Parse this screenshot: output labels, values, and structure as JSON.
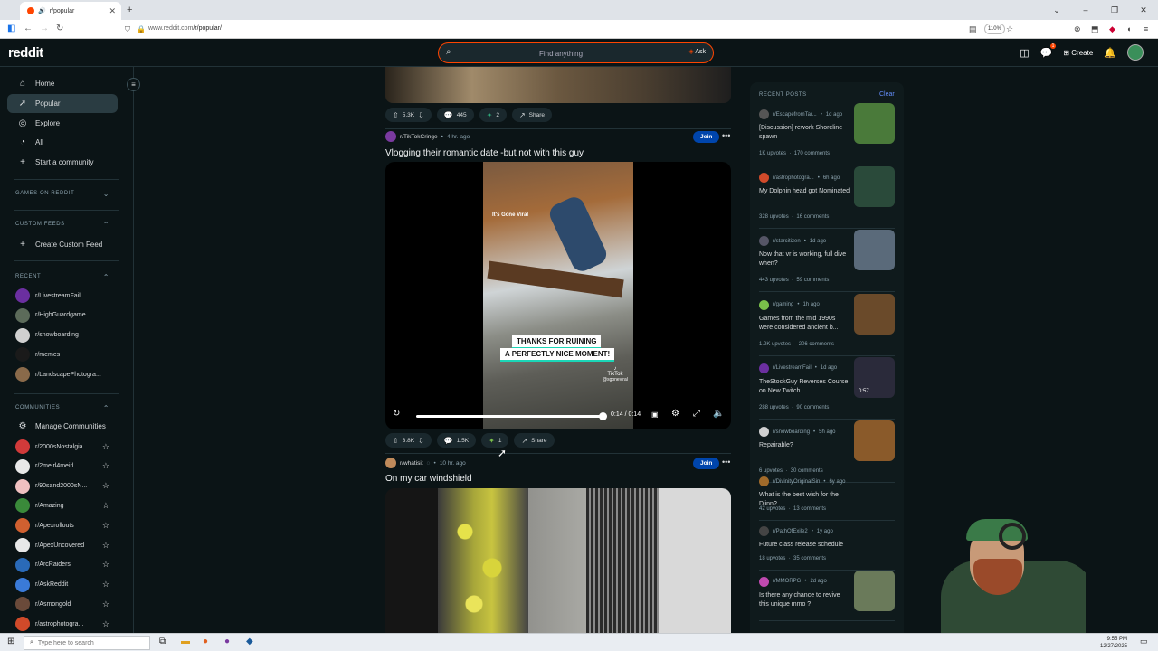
{
  "browser": {
    "tab_title": "r/popular",
    "url_host": "www.reddit.com",
    "url_path": "/r/popular/",
    "zoom": "110%"
  },
  "header": {
    "logo": "reddit",
    "search_placeholder": "Find anything",
    "ask_label": "Ask",
    "create_label": "Create",
    "chat_badge": "1"
  },
  "sidebar": {
    "nav": [
      {
        "label": "Home",
        "icon": "home-icon"
      },
      {
        "label": "Popular",
        "icon": "popular-icon"
      },
      {
        "label": "Explore",
        "icon": "explore-icon"
      },
      {
        "label": "All",
        "icon": "all-icon"
      },
      {
        "label": "Start a community",
        "icon": "plus-icon"
      }
    ],
    "games_header": "GAMES ON REDDIT",
    "custom_feeds_header": "CUSTOM FEEDS",
    "create_custom_feed": "Create Custom Feed",
    "recent_header": "RECENT",
    "recent": [
      {
        "name": "r/LivestreamFail",
        "color": "#6b2fa0"
      },
      {
        "name": "r/HighGuardgame",
        "color": "#5c6b5a"
      },
      {
        "name": "r/snowboarding",
        "color": "#d0d0d0"
      },
      {
        "name": "r/memes",
        "color": "#1a1a1a"
      },
      {
        "name": "r/LandscapePhotogra...",
        "color": "#8a6a4a"
      }
    ],
    "communities_header": "COMMUNITIES",
    "manage_communities": "Manage Communities",
    "communities": [
      {
        "name": "r/2000sNostalgia",
        "color": "#d13a3a"
      },
      {
        "name": "r/2meirl4meirl",
        "color": "#e8e8e8"
      },
      {
        "name": "r/90sand2000sN...",
        "color": "#f0c0c0"
      },
      {
        "name": "r/Amazing",
        "color": "#3a8a3a"
      },
      {
        "name": "r/Apexrollouts",
        "color": "#d06030"
      },
      {
        "name": "r/ApexUncovered",
        "color": "#e8e8e8"
      },
      {
        "name": "r/ArcRaiders",
        "color": "#2a6ab8"
      },
      {
        "name": "r/AskReddit",
        "color": "#3a7ad8"
      },
      {
        "name": "r/Asmongold",
        "color": "#6a4a3a"
      },
      {
        "name": "r/astrophotogra...",
        "color": "#d04a2a"
      }
    ]
  },
  "feed": {
    "post1": {
      "upvotes": "5.3K",
      "comments": "445",
      "awards": "2",
      "share": "Share"
    },
    "post2": {
      "subreddit": "r/TikTokCringe",
      "age": "4 hr. ago",
      "join": "Join",
      "title": "Vlogging their romantic date -but not with this guy",
      "video_overlay": "It's Gone Viral",
      "caption_line1": "THANKS FOR RUINING",
      "caption_line2": "A PERFECTLY NICE MOMENT!",
      "tiktok_label": "TikTok",
      "tiktok_handle": "@sgoneviral",
      "time": "0:14 / 0:14",
      "progress": 1.0,
      "upvotes": "3.8K",
      "comments": "1.5K",
      "awards": "1",
      "share": "Share"
    },
    "post3": {
      "subreddit": "r/whatisit",
      "age": "10 hr. ago",
      "join": "Join",
      "title": "On my car windshield"
    }
  },
  "recent_posts": {
    "header": "RECENT POSTS",
    "clear": "Clear",
    "items": [
      {
        "sub": "r/EscapefromTar...",
        "age": "1d ago",
        "title": "[Discussion] rework Shoreline spawn",
        "upvotes": "1K upvotes",
        "comments": "170 comments",
        "avatar": "#555",
        "thumb": "#4a7a3a"
      },
      {
        "sub": "r/astrophotogra...",
        "age": "6h ago",
        "title": "My Dolphin head got Nominated",
        "upvotes": "328 upvotes",
        "comments": "16 comments",
        "avatar": "#d04a2a",
        "thumb": "#2a4a3a"
      },
      {
        "sub": "r/starcitizen",
        "age": "1d ago",
        "title": "Now that vr is working, full dive when?",
        "upvotes": "443 upvotes",
        "comments": "59 comments",
        "avatar": "#556",
        "thumb": "#5a6a7a"
      },
      {
        "sub": "r/gaming",
        "age": "1h ago",
        "title": "Games from the mid 1990s were considered ancient b...",
        "upvotes": "1.2K upvotes",
        "comments": "206 comments",
        "avatar": "#7ac04a",
        "thumb": "#6a4a2a"
      },
      {
        "sub": "r/LivestreamFail",
        "age": "1d ago",
        "title": "TheStockGuy Reverses Course on New Twitch...",
        "upvotes": "288 upvotes",
        "comments": "90 comments",
        "avatar": "#6b2fa0",
        "thumb": "#2a2a3a",
        "duration": "0:57"
      },
      {
        "sub": "r/snowboarding",
        "age": "5h ago",
        "title": "Repairable?",
        "upvotes": "6 upvotes",
        "comments": "30 comments",
        "avatar": "#d0d0d0",
        "thumb": "#8a5a2a"
      },
      {
        "sub": "r/DivinityOriginalSin",
        "age": "6y ago",
        "title": "What is the best wish for the Djinn?",
        "upvotes": "42 upvotes",
        "comments": "13 comments",
        "avatar": "#a06a2a",
        "thumb": null
      },
      {
        "sub": "r/PathOfExile2",
        "age": "1y ago",
        "title": "Future class release schedule",
        "upvotes": "18 upvotes",
        "comments": "35 comments",
        "avatar": "#444",
        "thumb": null
      },
      {
        "sub": "r/MMORPG",
        "age": "2d ago",
        "title": "Is there any chance to revive this unique mmo ?",
        "upvotes": "",
        "comments": "",
        "avatar": "#c04ab0",
        "thumb": "#6a7a5a"
      }
    ]
  },
  "taskbar": {
    "search_placeholder": "Type here to search",
    "time": "9:55 PM",
    "date": "12/27/2025"
  }
}
